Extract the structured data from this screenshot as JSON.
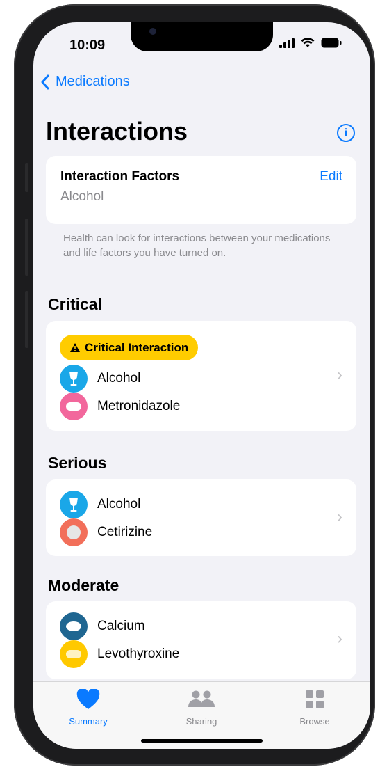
{
  "status_bar": {
    "time": "10:09"
  },
  "nav": {
    "back_label": "Medications"
  },
  "page": {
    "title": "Interactions"
  },
  "factors_card": {
    "title": "Interaction Factors",
    "value": "Alcohol",
    "edit_label": "Edit"
  },
  "footnote": "Health can look for interactions between your medications and life factors you have turned on.",
  "sections": {
    "critical": {
      "heading": "Critical",
      "badge": "Critical Interaction",
      "items": [
        "Alcohol",
        "Metronidazole"
      ]
    },
    "serious": {
      "heading": "Serious",
      "items": [
        "Alcohol",
        "Cetirizine"
      ]
    },
    "moderate": {
      "heading": "Moderate",
      "items": [
        "Calcium",
        "Levothyroxine"
      ]
    }
  },
  "icons": {
    "alcohol": {
      "name": "wine-glass-icon",
      "color": "#1aa7e8"
    },
    "metronidazole": {
      "name": "capsule-icon",
      "color": "#f2679c"
    },
    "cetirizine": {
      "name": "round-pill-icon",
      "color": "#f26f5a"
    },
    "calcium": {
      "name": "oval-pill-icon",
      "color": "#1f6691"
    },
    "levothyroxine": {
      "name": "capsule-icon",
      "color": "#ffc900"
    }
  },
  "tabbar": {
    "tabs": [
      {
        "label": "Summary",
        "icon": "heart-icon",
        "active": true
      },
      {
        "label": "Sharing",
        "icon": "people-icon",
        "active": false
      },
      {
        "label": "Browse",
        "icon": "grid-icon",
        "active": false
      }
    ]
  },
  "colors": {
    "accent": "#0a7aff",
    "critical": "#ffcc00",
    "background": "#f2f2f7"
  }
}
